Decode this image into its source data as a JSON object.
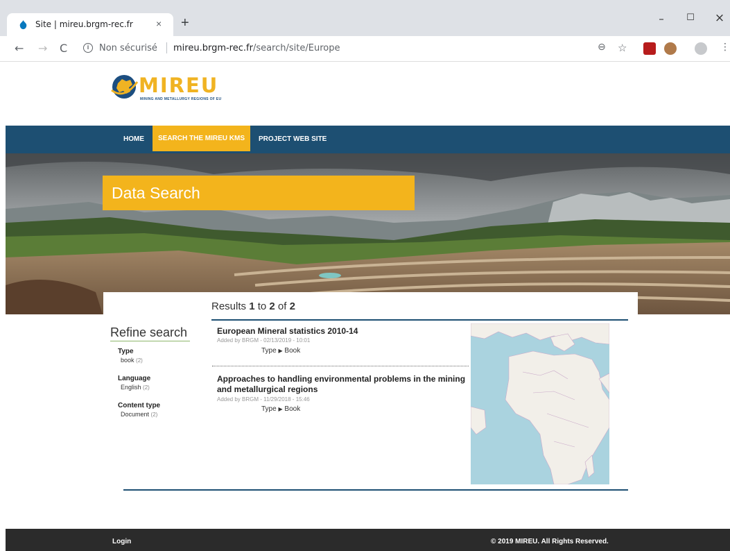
{
  "browser": {
    "tab_title": "Site | mireu.brgm-rec.fr",
    "tab_close": "×",
    "new_tab": "+",
    "window_controls": {
      "minimize": "–",
      "maximize": "☐",
      "close": "×"
    },
    "security_label": "Non sécurisé",
    "url_host": "mireu.brgm-rec.fr",
    "url_path": "/search/site/Europe",
    "icons": [
      "back-icon",
      "forward-icon",
      "reload-icon",
      "info-icon",
      "zoom-icon",
      "star-icon",
      "pdf-extension-icon",
      "cookie-extension-icon",
      "profile-icon",
      "menu-icon"
    ]
  },
  "site": {
    "logo_text": "MIREU",
    "logo_subtitle": "MINING AND METALLURGY REGIONS OF EU",
    "nav": [
      {
        "label": "HOME",
        "active": false
      },
      {
        "label": "SEARCH THE MIREU KMS",
        "active": true
      },
      {
        "label": "PROJECT WEB SITE",
        "active": false
      }
    ],
    "hero_title": "Data Search",
    "accent_color": "#f3b41c",
    "nav_color": "#1d4f72"
  },
  "results": {
    "prefix": "Results ",
    "from": "1",
    "to_word": " to ",
    "to": "2",
    "of_word": " of ",
    "total": "2",
    "items": [
      {
        "title": "European Mineral statistics 2010-14",
        "meta": "Added by BRGM - 02/13/2019 - 10:01",
        "type_label": "Type",
        "type_value": "Book"
      },
      {
        "title": "Approaches to handling environmental problems in the mining and metallurgical regions",
        "meta": "Added by BRGM - 11/29/2018 - 15:46",
        "type_label": "Type",
        "type_value": "Book"
      }
    ]
  },
  "refine": {
    "title": "Refine search",
    "facets": [
      {
        "title": "Type",
        "value": "book",
        "count": "(2)"
      },
      {
        "title": "Language",
        "value": "English",
        "count": "(2)"
      },
      {
        "title": "Content type",
        "value": "Document",
        "count": "(2)"
      }
    ]
  },
  "footer": {
    "login": "Login",
    "copyright": "© 2019 MIREU. All Rights Reserved."
  }
}
